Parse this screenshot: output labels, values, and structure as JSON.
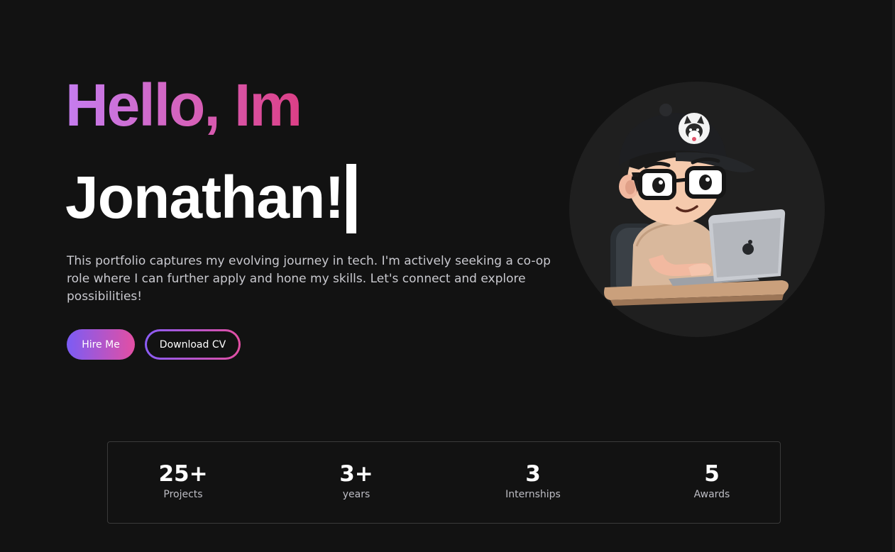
{
  "hero": {
    "greeting": "Hello, Im",
    "name": "Jonathan!",
    "intro": "This portfolio captures my evolving journey in tech. I'm actively seeking a co-op role where I can further apply and hone my skills. Let's connect and explore possibilities!",
    "hire_label": "Hire Me",
    "cv_label": "Download CV",
    "avatar_icon": "developer-avatar-icon"
  },
  "colors": {
    "background": "#121212",
    "gradient_start": "#7b5cf5",
    "gradient_end": "#e34fa3",
    "greeting_start": "#c57df0",
    "greeting_end": "#dc3f86"
  },
  "stats": [
    {
      "value": "25+",
      "label": "Projects"
    },
    {
      "value": "3+",
      "label": "years"
    },
    {
      "value": "3",
      "label": "Internships"
    },
    {
      "value": "5",
      "label": "Awards"
    }
  ]
}
